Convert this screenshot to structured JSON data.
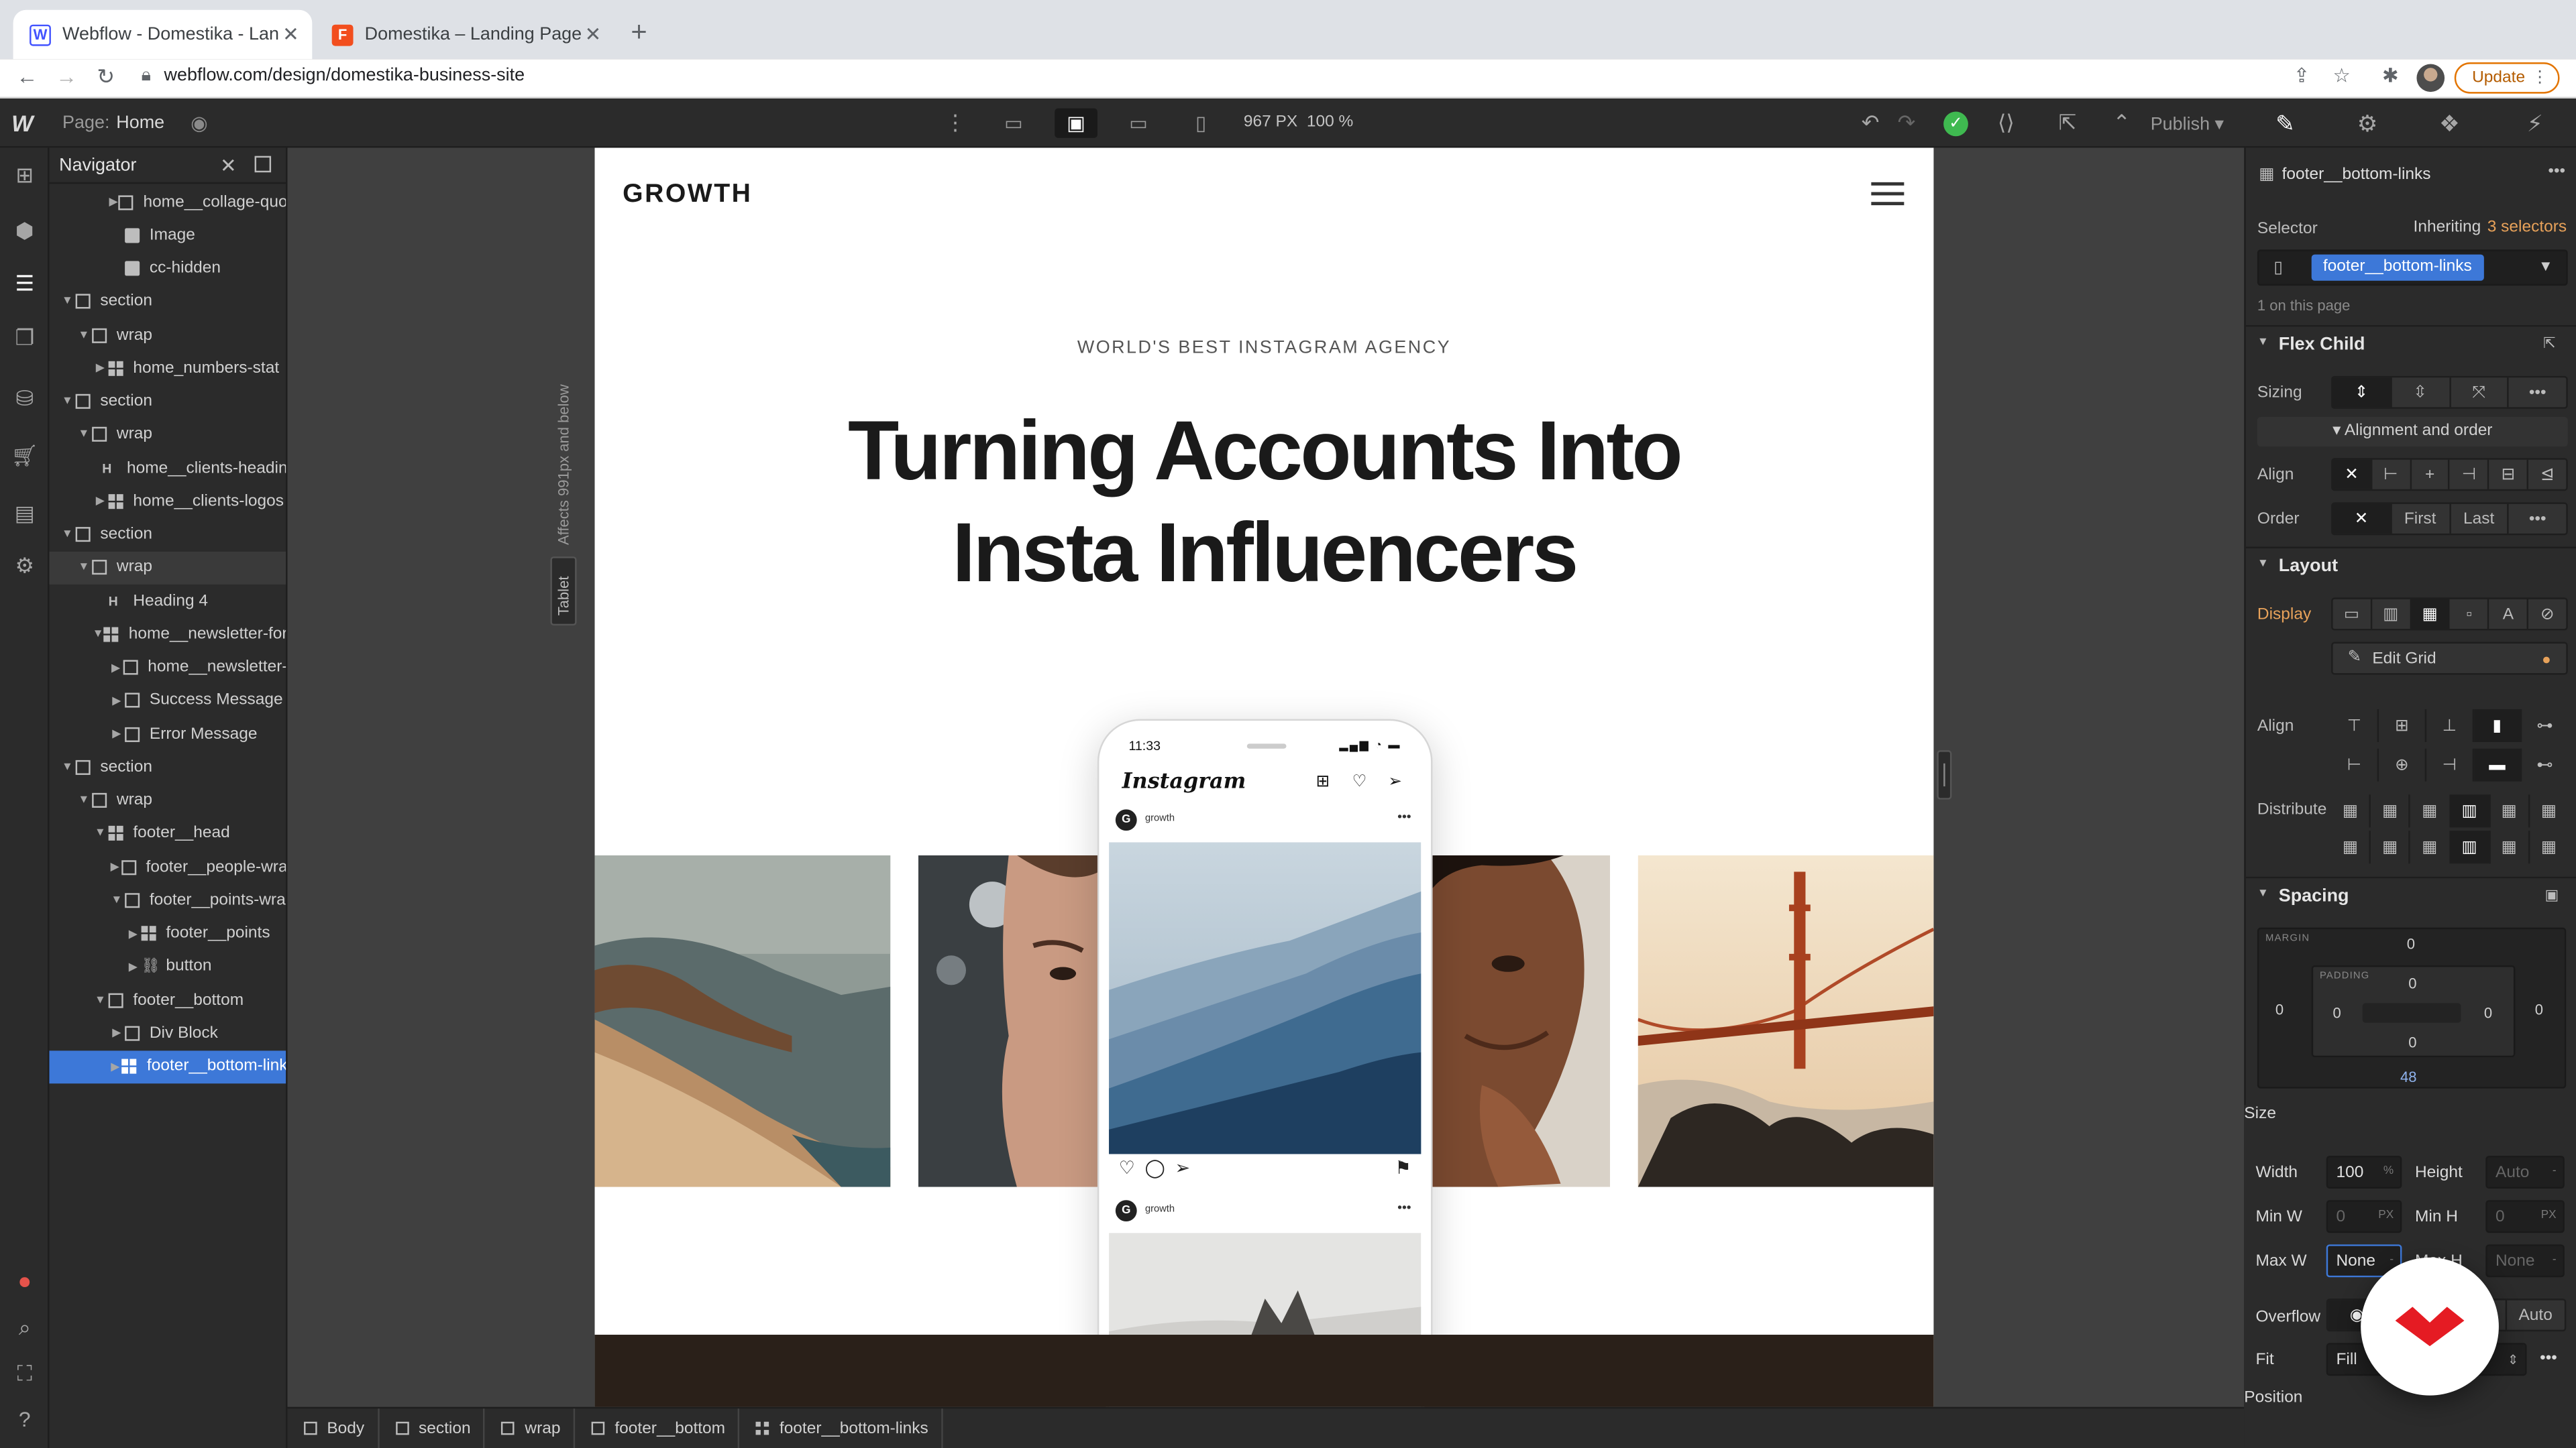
{
  "browser": {
    "tabs": [
      {
        "title": "Webflow - Domestika - Landing",
        "favicon": "W",
        "color": "#4353ff",
        "active": true
      },
      {
        "title": "Domestika – Landing Page – Fi",
        "favicon": "F",
        "color": "#f24e1e",
        "active": false
      }
    ],
    "url": "webflow.com/design/domestika-business-site",
    "update_label": "Update"
  },
  "toolbar": {
    "page_label": "Page:",
    "page_name": "Home",
    "width_value": "967 PX",
    "zoom_value": "100 %",
    "publish_label": "Publish"
  },
  "navigator": {
    "title": "Navigator",
    "items": [
      {
        "label": "home__collage-quo",
        "depth": 3,
        "icon": "box",
        "caret": "right"
      },
      {
        "label": "Image",
        "depth": 3,
        "icon": "img",
        "caret": ""
      },
      {
        "label": "cc-hidden",
        "depth": 3,
        "icon": "img",
        "caret": ""
      },
      {
        "label": "section",
        "depth": 0,
        "icon": "box",
        "caret": "down"
      },
      {
        "label": "wrap",
        "depth": 1,
        "icon": "box",
        "caret": "down"
      },
      {
        "label": "home_numbers-stat",
        "depth": 2,
        "icon": "grid",
        "caret": "right"
      },
      {
        "label": "section",
        "depth": 0,
        "icon": "box",
        "caret": "down"
      },
      {
        "label": "wrap",
        "depth": 1,
        "icon": "box",
        "caret": "down"
      },
      {
        "label": "home__clients-headin",
        "depth": 2,
        "icon": "h",
        "caret": ""
      },
      {
        "label": "home__clients-logos",
        "depth": 2,
        "icon": "grid",
        "caret": "right"
      },
      {
        "label": "section",
        "depth": 0,
        "icon": "box",
        "caret": "down"
      },
      {
        "label": "wrap",
        "depth": 1,
        "icon": "box",
        "caret": "down",
        "state": "hl"
      },
      {
        "label": "Heading 4",
        "depth": 2,
        "icon": "h",
        "caret": ""
      },
      {
        "label": "home__newsletter-for",
        "depth": 2,
        "icon": "grid",
        "caret": "down"
      },
      {
        "label": "home__newsletter-",
        "depth": 3,
        "icon": "box",
        "caret": "right"
      },
      {
        "label": "Success Message",
        "depth": 3,
        "icon": "box",
        "caret": "right"
      },
      {
        "label": "Error Message",
        "depth": 3,
        "icon": "box",
        "caret": "right"
      },
      {
        "label": "section",
        "depth": 0,
        "icon": "box",
        "caret": "down"
      },
      {
        "label": "wrap",
        "depth": 1,
        "icon": "box",
        "caret": "down"
      },
      {
        "label": "footer__head",
        "depth": 2,
        "icon": "grid",
        "caret": "down"
      },
      {
        "label": "footer__people-wra",
        "depth": 3,
        "icon": "box",
        "caret": "right"
      },
      {
        "label": "footer__points-wra",
        "depth": 3,
        "icon": "box",
        "caret": "down"
      },
      {
        "label": "footer__points",
        "depth": 4,
        "icon": "grid",
        "caret": "right"
      },
      {
        "label": "button",
        "depth": 4,
        "icon": "link",
        "caret": "right"
      },
      {
        "label": "footer__bottom",
        "depth": 2,
        "icon": "box",
        "caret": "down"
      },
      {
        "label": "Div Block",
        "depth": 3,
        "icon": "box",
        "caret": "right"
      },
      {
        "label": "footer__bottom-link",
        "depth": 3,
        "icon": "grid",
        "caret": "right",
        "state": "sel"
      }
    ]
  },
  "canvas": {
    "breakpoint_note": "Affects 991px and below",
    "breakpoint_tag": "Tablet",
    "site": {
      "logo": "GROWTH",
      "eyebrow": "WORLD'S BEST INSTAGRAM AGENCY",
      "heading_line1": "Turning Accounts Into",
      "heading_line2": "Insta Influencers",
      "phone": {
        "time": "11:33",
        "app_name": "Instagram",
        "post_user": "growth"
      }
    }
  },
  "breadcrumb": [
    {
      "label": "Body",
      "icon": "box"
    },
    {
      "label": "section",
      "icon": "box"
    },
    {
      "label": "wrap",
      "icon": "box"
    },
    {
      "label": "footer__bottom",
      "icon": "box"
    },
    {
      "label": "footer__bottom-links",
      "icon": "grid"
    }
  ],
  "style_panel": {
    "element_name": "footer__bottom-links",
    "selector_label": "Selector",
    "inheriting_label": "Inheriting",
    "inheriting_count": "3 selectors",
    "selector_value": "footer__bottom-links",
    "on_page": "1 on this page",
    "flex_child": {
      "title": "Flex Child",
      "sizing_label": "Sizing",
      "alignment_toggle": "Alignment and order",
      "align_label": "Align",
      "order_label": "Order",
      "order_first": "First",
      "order_last": "Last"
    },
    "layout": {
      "title": "Layout",
      "display_label": "Display",
      "edit_grid": "Edit Grid",
      "align_label": "Align",
      "distribute_label": "Distribute"
    },
    "spacing": {
      "title": "Spacing",
      "margin_caption": "MARGIN",
      "padding_caption": "PADDING",
      "margin_top": "0",
      "margin_left": "0",
      "margin_right": "0",
      "margin_bottom": "48",
      "padding_top": "0",
      "padding_left": "0",
      "padding_right": "0",
      "padding_bottom": "0"
    },
    "size": {
      "title": "Size",
      "width_label": "Width",
      "width_value": "100",
      "width_unit": "%",
      "height_label": "Height",
      "height_value": "Auto",
      "min_w_label": "Min W",
      "min_w_value": "0",
      "min_w_unit": "PX",
      "min_h_label": "Min H",
      "min_h_value": "0",
      "min_h_unit": "PX",
      "max_w_label": "Max W",
      "max_w_value": "None",
      "max_h_label": "Max H",
      "max_h_value": "None",
      "overflow_label": "Overflow",
      "overflow_auto": "Auto",
      "fit_label": "Fit",
      "fit_value": "Fill"
    },
    "position_title": "Position"
  },
  "colors": {
    "selection_blue": "#3d78d8",
    "publish_ok_green": "#3fb950",
    "domestika_red": "#e51b23",
    "inherit_orange": "#e8a25a"
  }
}
